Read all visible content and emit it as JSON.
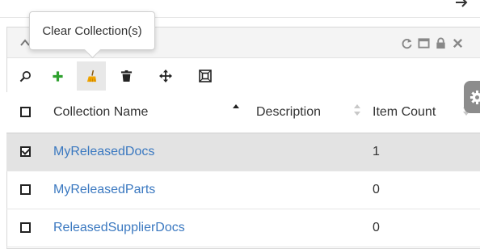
{
  "tooltip": {
    "text": "Clear Collection(s)"
  },
  "toolbar": {
    "buttons": [
      "search-icon",
      "add-icon",
      "broom-icon",
      "trash-icon",
      "move-icon",
      "fit-icon"
    ]
  },
  "colors": {
    "link": "#3a78c0",
    "add": "#2fa12f",
    "broom": "#f0a400",
    "selected_row": "#e3e3e3"
  },
  "table": {
    "columns": [
      "Collection Name",
      "Description",
      "Item Count"
    ],
    "sort": {
      "column": "Collection Name",
      "direction": "ascending"
    },
    "rows": [
      {
        "name": "MyReleasedDocs",
        "description": "",
        "count": "1",
        "checked": true
      },
      {
        "name": "MyReleasedParts",
        "description": "",
        "count": "0",
        "checked": false
      },
      {
        "name": "ReleasedSupplierDocs",
        "description": "",
        "count": "0",
        "checked": false
      }
    ]
  }
}
